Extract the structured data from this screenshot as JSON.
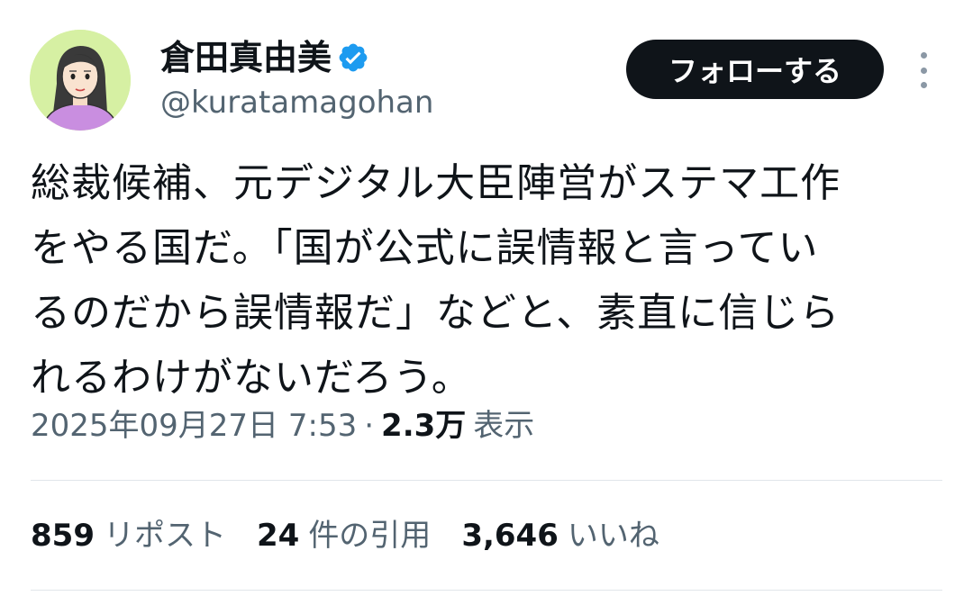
{
  "author": {
    "display_name": "倉田真由美",
    "handle": "@kuratamagohan",
    "verified": true,
    "verified_color": "#1d9bf0"
  },
  "actions": {
    "follow_label": "フォローする"
  },
  "tweet": {
    "lines": [
      "総裁候補、元デジタル大臣陣営がステマ工作",
      "をやる国だ。「国が公式に誤情報と言ってい",
      "るのだから誤情報だ」などと、素直に信じら",
      "れるわけがないだろう。"
    ]
  },
  "meta": {
    "timestamp": "2025年09月27日 7:53",
    "separator": "·",
    "views_count": "2.3万",
    "views_label": "表示"
  },
  "stats": {
    "reposts_count": "859",
    "reposts_label": "リポスト",
    "quotes_count": "24",
    "quotes_label": "件の引用",
    "likes_count": "3,646",
    "likes_label": "いいね"
  }
}
